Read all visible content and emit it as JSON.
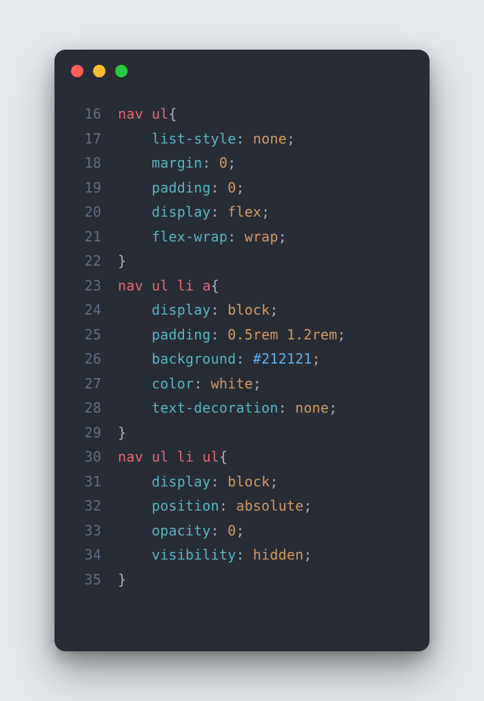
{
  "colors": {
    "background": "#e4e9ed",
    "editor_bg": "#282c34",
    "line_number": "#636d83",
    "tag": "#e06c75",
    "property": "#56b6c2",
    "value": "#d19a66",
    "punctuation": "#abb2bf",
    "identifier": "#61afef",
    "dot_red": "#ff5f56",
    "dot_yellow": "#ffbd2e",
    "dot_green": "#27c93f"
  },
  "lines": [
    {
      "num": "16",
      "tokens": [
        {
          "t": "tag",
          "s": "nav"
        },
        {
          "t": "punct",
          "s": " "
        },
        {
          "t": "tag",
          "s": "ul"
        },
        {
          "t": "punct",
          "s": "{"
        }
      ]
    },
    {
      "num": "17",
      "tokens": [
        {
          "t": "punct",
          "s": "    "
        },
        {
          "t": "prop",
          "s": "list-style"
        },
        {
          "t": "punct",
          "s": ": "
        },
        {
          "t": "val",
          "s": "none"
        },
        {
          "t": "punct",
          "s": ";"
        }
      ]
    },
    {
      "num": "18",
      "tokens": [
        {
          "t": "punct",
          "s": "    "
        },
        {
          "t": "prop",
          "s": "margin"
        },
        {
          "t": "punct",
          "s": ": "
        },
        {
          "t": "val",
          "s": "0"
        },
        {
          "t": "punct",
          "s": ";"
        }
      ]
    },
    {
      "num": "19",
      "tokens": [
        {
          "t": "punct",
          "s": "    "
        },
        {
          "t": "prop",
          "s": "padding"
        },
        {
          "t": "punct",
          "s": ": "
        },
        {
          "t": "val",
          "s": "0"
        },
        {
          "t": "punct",
          "s": ";"
        }
      ]
    },
    {
      "num": "20",
      "tokens": [
        {
          "t": "punct",
          "s": "    "
        },
        {
          "t": "prop",
          "s": "display"
        },
        {
          "t": "punct",
          "s": ": "
        },
        {
          "t": "val",
          "s": "flex"
        },
        {
          "t": "punct",
          "s": ";"
        }
      ]
    },
    {
      "num": "21",
      "tokens": [
        {
          "t": "punct",
          "s": "    "
        },
        {
          "t": "prop",
          "s": "flex-wrap"
        },
        {
          "t": "punct",
          "s": ": "
        },
        {
          "t": "val",
          "s": "wrap"
        },
        {
          "t": "punct",
          "s": ";"
        }
      ]
    },
    {
      "num": "22",
      "tokens": [
        {
          "t": "punct",
          "s": "}"
        }
      ]
    },
    {
      "num": "23",
      "tokens": [
        {
          "t": "tag",
          "s": "nav"
        },
        {
          "t": "punct",
          "s": " "
        },
        {
          "t": "tag",
          "s": "ul"
        },
        {
          "t": "punct",
          "s": " "
        },
        {
          "t": "tag",
          "s": "li"
        },
        {
          "t": "punct",
          "s": " "
        },
        {
          "t": "tag",
          "s": "a"
        },
        {
          "t": "punct",
          "s": "{"
        }
      ]
    },
    {
      "num": "24",
      "tokens": [
        {
          "t": "punct",
          "s": "    "
        },
        {
          "t": "prop",
          "s": "display"
        },
        {
          "t": "punct",
          "s": ": "
        },
        {
          "t": "val",
          "s": "block"
        },
        {
          "t": "punct",
          "s": ";"
        }
      ]
    },
    {
      "num": "25",
      "tokens": [
        {
          "t": "punct",
          "s": "    "
        },
        {
          "t": "prop",
          "s": "padding"
        },
        {
          "t": "punct",
          "s": ": "
        },
        {
          "t": "val",
          "s": "0.5rem 1.2rem"
        },
        {
          "t": "punct",
          "s": ";"
        }
      ]
    },
    {
      "num": "26",
      "tokens": [
        {
          "t": "punct",
          "s": "    "
        },
        {
          "t": "prop",
          "s": "background"
        },
        {
          "t": "punct",
          "s": ": "
        },
        {
          "t": "ident",
          "s": "#212121"
        },
        {
          "t": "punct",
          "s": ";"
        }
      ]
    },
    {
      "num": "27",
      "tokens": [
        {
          "t": "punct",
          "s": "    "
        },
        {
          "t": "prop",
          "s": "color"
        },
        {
          "t": "punct",
          "s": ": "
        },
        {
          "t": "val",
          "s": "white"
        },
        {
          "t": "punct",
          "s": ";"
        }
      ]
    },
    {
      "num": "28",
      "tokens": [
        {
          "t": "punct",
          "s": "    "
        },
        {
          "t": "prop",
          "s": "text-decoration"
        },
        {
          "t": "punct",
          "s": ": "
        },
        {
          "t": "val",
          "s": "none"
        },
        {
          "t": "punct",
          "s": ";"
        }
      ]
    },
    {
      "num": "29",
      "tokens": [
        {
          "t": "punct",
          "s": "}"
        }
      ]
    },
    {
      "num": "30",
      "tokens": [
        {
          "t": "tag",
          "s": "nav"
        },
        {
          "t": "punct",
          "s": " "
        },
        {
          "t": "tag",
          "s": "ul"
        },
        {
          "t": "punct",
          "s": " "
        },
        {
          "t": "tag",
          "s": "li"
        },
        {
          "t": "punct",
          "s": " "
        },
        {
          "t": "tag",
          "s": "ul"
        },
        {
          "t": "punct",
          "s": "{"
        }
      ]
    },
    {
      "num": "31",
      "tokens": [
        {
          "t": "punct",
          "s": "    "
        },
        {
          "t": "prop",
          "s": "display"
        },
        {
          "t": "punct",
          "s": ": "
        },
        {
          "t": "val",
          "s": "block"
        },
        {
          "t": "punct",
          "s": ";"
        }
      ]
    },
    {
      "num": "32",
      "tokens": [
        {
          "t": "punct",
          "s": "    "
        },
        {
          "t": "prop",
          "s": "position"
        },
        {
          "t": "punct",
          "s": ": "
        },
        {
          "t": "val",
          "s": "absolute"
        },
        {
          "t": "punct",
          "s": ";"
        }
      ]
    },
    {
      "num": "33",
      "tokens": [
        {
          "t": "punct",
          "s": "    "
        },
        {
          "t": "prop",
          "s": "opacity"
        },
        {
          "t": "punct",
          "s": ": "
        },
        {
          "t": "val",
          "s": "0"
        },
        {
          "t": "punct",
          "s": ";"
        }
      ]
    },
    {
      "num": "34",
      "tokens": [
        {
          "t": "punct",
          "s": "    "
        },
        {
          "t": "prop",
          "s": "visibility"
        },
        {
          "t": "punct",
          "s": ": "
        },
        {
          "t": "val",
          "s": "hidden"
        },
        {
          "t": "punct",
          "s": ";"
        }
      ]
    },
    {
      "num": "35",
      "tokens": [
        {
          "t": "punct",
          "s": "}"
        }
      ]
    }
  ]
}
